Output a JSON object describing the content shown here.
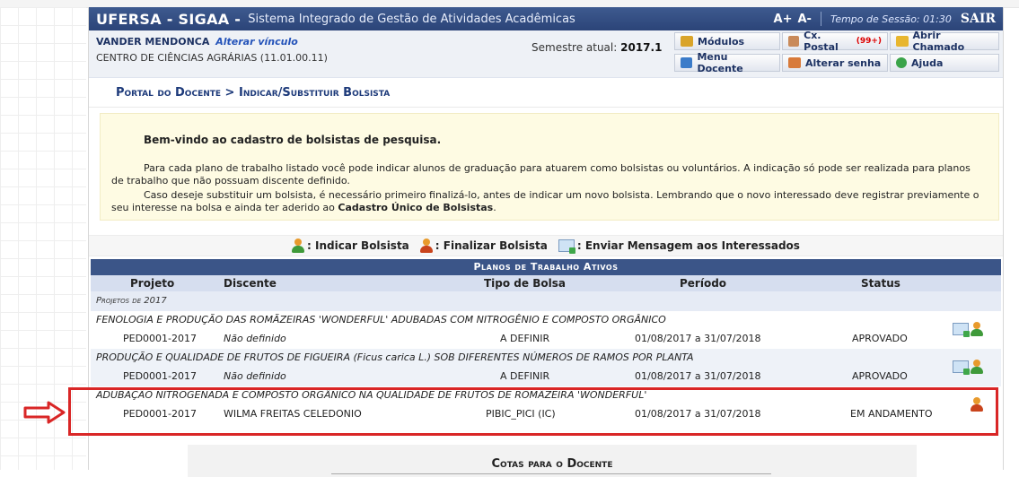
{
  "header": {
    "brand": "UFERSA - SIGAA -",
    "subtitle": "Sistema Integrado de Gestão de Atividades Acadêmicas",
    "font_plus": "A+",
    "font_minus": "A-",
    "session_label": "Tempo de Sessão: 01:30",
    "logout": "SAIR"
  },
  "user": {
    "name": "VANDER MENDONCA",
    "change_link": "Alterar vínculo",
    "department": "CENTRO DE CIÊNCIAS AGRÁRIAS (11.01.00.11)",
    "semester_label": "Semestre atual:",
    "semester_value": "2017.1"
  },
  "quick_links": {
    "modulos": "Módulos",
    "caixa_postal": "Cx. Postal",
    "caixa_badge": "(99+)",
    "abrir_chamado": "Abrir Chamado",
    "menu_docente": "Menu Docente",
    "alterar_senha": "Alterar senha",
    "ajuda": "Ajuda"
  },
  "breadcrumb": "Portal do Docente > Indicar/Substituir Bolsista",
  "info": {
    "welcome": "Bem-vindo ao cadastro de bolsistas de pesquisa.",
    "p1": "Para cada plano de trabalho listado você pode indicar alunos de graduação para atuarem como bolsistas ou voluntários. A indicação só pode ser realizada para planos de trabalho que não possuam discente definido.",
    "p2_start": "Caso deseje substituir um bolsista, é necessário primeiro finalizá-lo, antes de indicar um novo bolsista. Lembrando que o novo interessado deve registrar previamente o seu interesse na bolsa e ainda ter aderido ao ",
    "p2_bold": "Cadastro Único de Bolsistas",
    "p2_end": "."
  },
  "legend": {
    "indicar": ": Indicar Bolsista",
    "finalizar": ": Finalizar Bolsista",
    "enviar": ": Enviar Mensagem aos Interessados"
  },
  "table": {
    "title": "Planos de Trabalho Ativos",
    "columns": [
      "Projeto",
      "Discente",
      "Tipo de Bolsa",
      "Período",
      "Status"
    ],
    "group": "Projetos de 2017",
    "rows": [
      {
        "title": "FENOLOGIA E PRODUÇÃO DAS ROMÃZEIRAS 'WONDERFUL' ADUBADAS COM NITROGÊNIO E COMPOSTO ORGÂNICO",
        "projeto": "PED0001-2017",
        "discente": "Não definido",
        "tipo": "A DEFINIR",
        "periodo": "01/08/2017 a 31/07/2018",
        "status": "APROVADO"
      },
      {
        "title": "PRODUÇÃO E QUALIDADE DE FRUTOS DE FIGUEIRA (Ficus carica L.) SOB DIFERENTES NÚMEROS DE RAMOS POR PLANTA",
        "projeto": "PED0001-2017",
        "discente": "Não definido",
        "tipo": "A DEFINIR",
        "periodo": "01/08/2017 a 31/07/2018",
        "status": "APROVADO"
      },
      {
        "title": "ADUBAÇÃO NITROGENADA E COMPOSTO ORGÂNICO NA QUALIDADE DE FRUTOS DE ROMÃZEIRA 'WONDERFUL'",
        "projeto": "PED0001-2017",
        "discente": "WILMA FREITAS CELEDONIO",
        "tipo": "PIBIC_PICI (IC)",
        "periodo": "01/08/2017 a 31/07/2018",
        "status": "EM ANDAMENTO"
      }
    ]
  },
  "cotas_title": "Cotas para o Docente",
  "colors": {
    "header_bg": "#2b4478",
    "info_bg": "#fefbe3",
    "highlight": "#d92626"
  }
}
